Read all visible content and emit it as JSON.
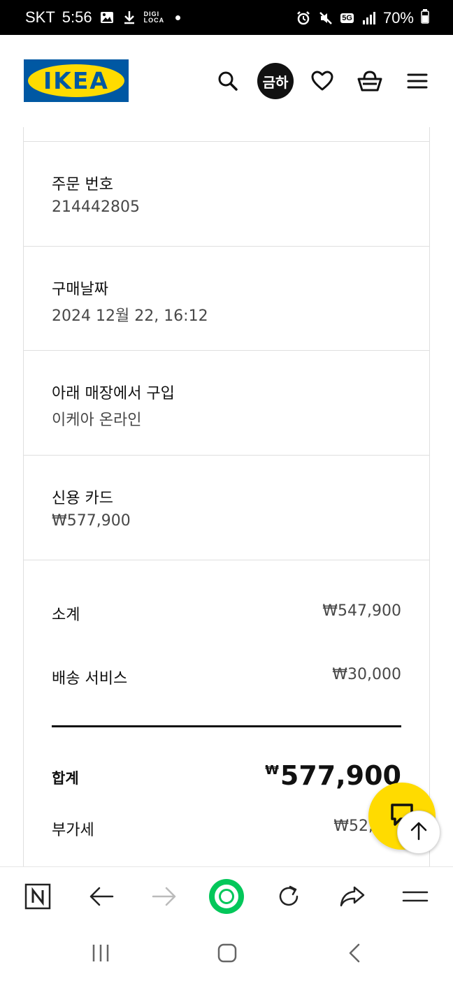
{
  "status_bar": {
    "carrier": "SKT",
    "time": "5:56",
    "digi_top": "DIGI",
    "digi_bottom": "LOCA",
    "network": "5G",
    "battery": "70%"
  },
  "header": {
    "logo_text": "IKEA",
    "store_badge": "금하",
    "icons": [
      "search-icon",
      "heart-icon",
      "basket-icon",
      "menu-icon"
    ]
  },
  "order": {
    "order_number_label": "주문 번호",
    "order_number": "214442805",
    "purchase_date_label": "구매날짜",
    "purchase_date": "2024 12월 22, 16:12",
    "store_label": "아래 매장에서 구입",
    "store": "이케아 온라인",
    "payment_label": "신용 카드",
    "payment_amount": "₩577,900"
  },
  "summary": {
    "subtotal_label": "소계",
    "subtotal": "₩547,900",
    "delivery_label": "배송 서비스",
    "delivery": "₩30,000",
    "total_label": "합계",
    "total_currency": "₩",
    "total": "577,900",
    "vat_label": "부가세",
    "vat": "₩52,"
  },
  "browser_toolbar": {
    "icons": [
      "naver-icon",
      "back-arrow-icon",
      "forward-arrow-icon",
      "home-icon",
      "refresh-icon",
      "share-icon",
      "menu-icon"
    ]
  },
  "colors": {
    "ikea_blue": "#0058a3",
    "ikea_yellow": "#ffdb00",
    "naver_green": "#03c75a"
  }
}
